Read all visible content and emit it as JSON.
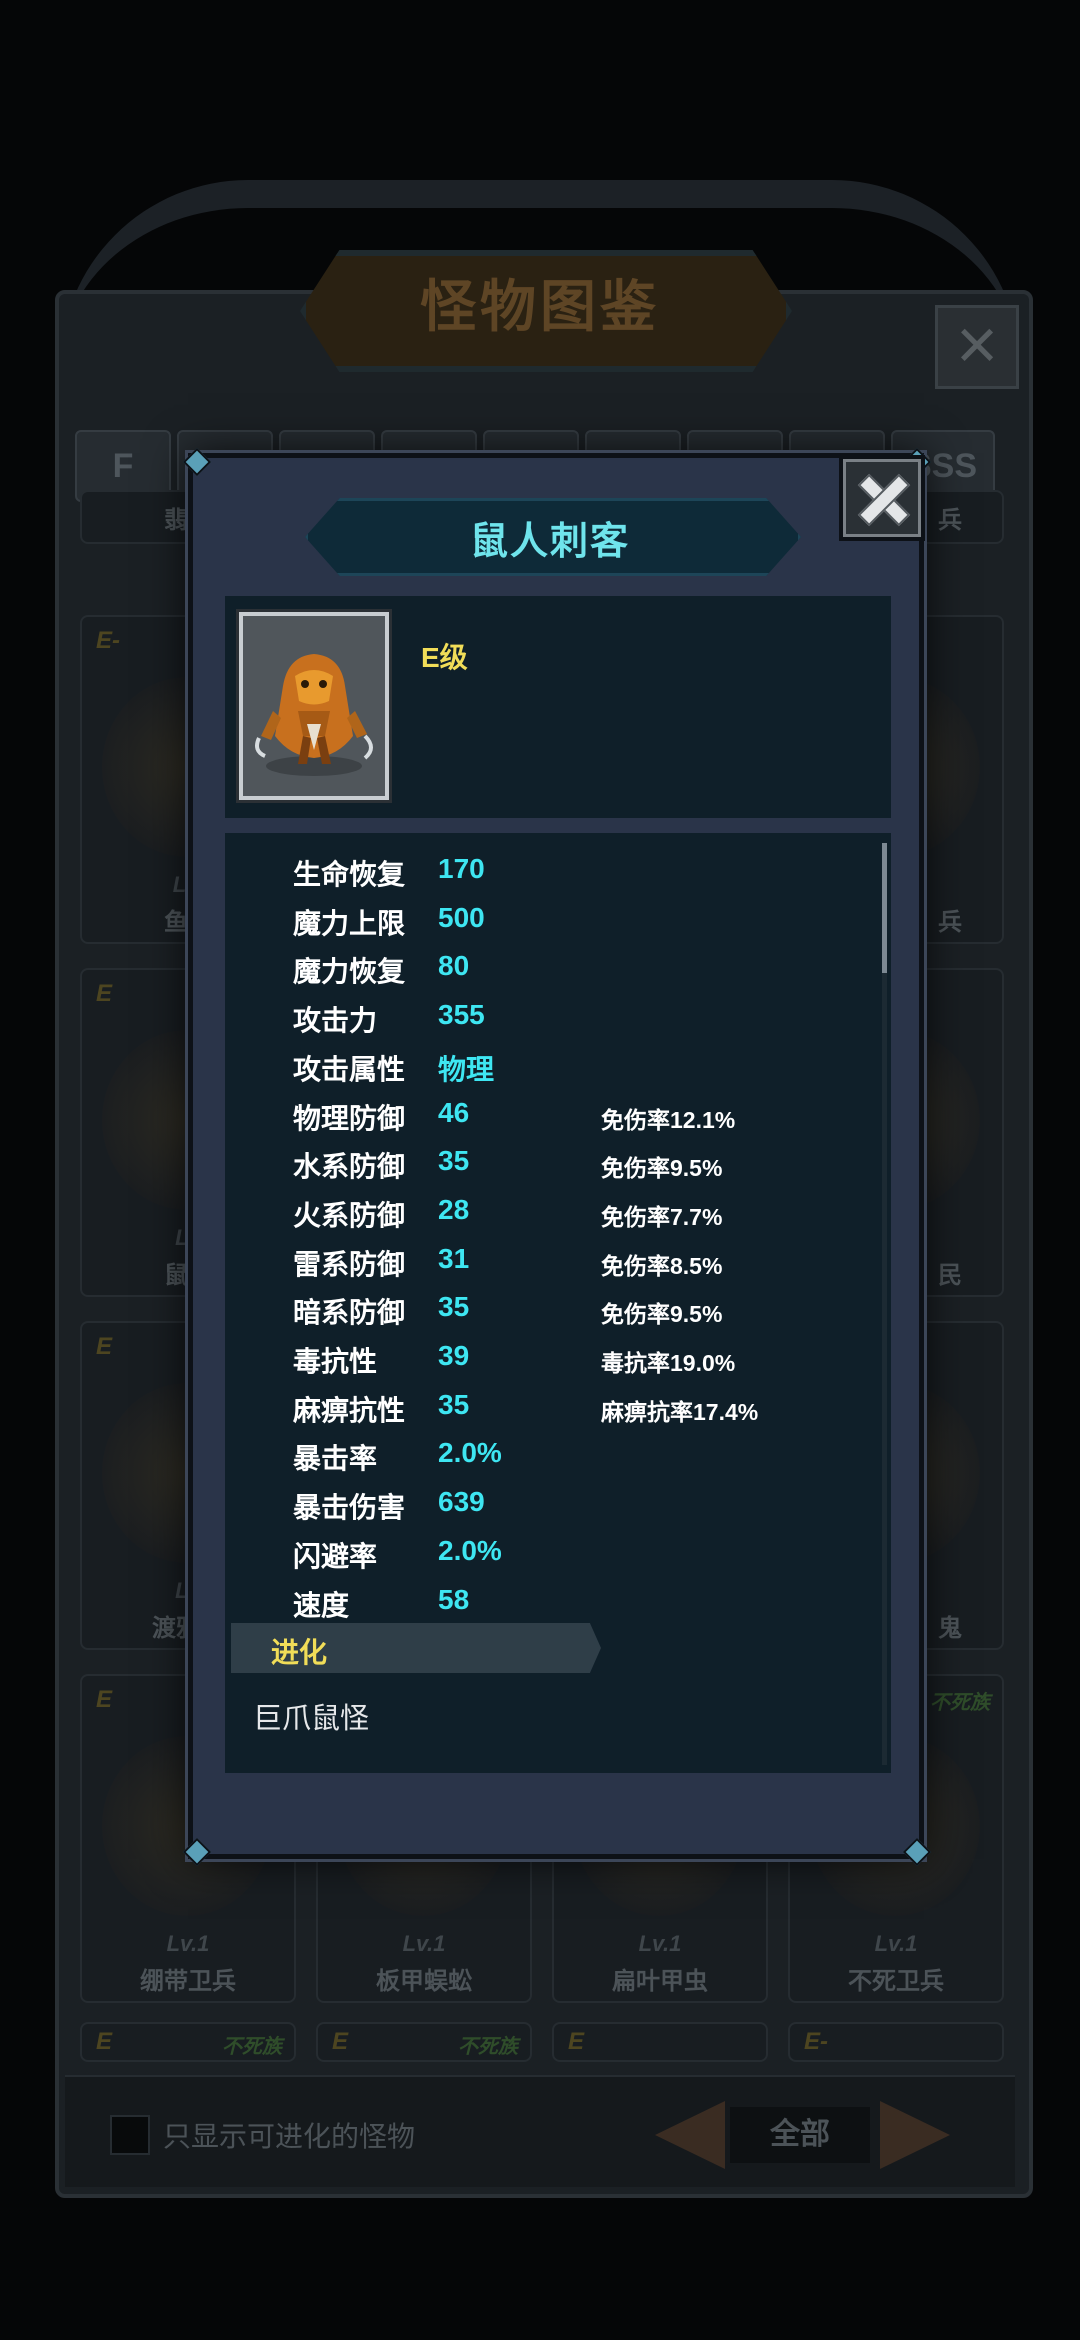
{
  "background": {
    "title": "怪物图鉴",
    "close_icon": "close-icon",
    "tabs": [
      "F",
      "",
      "",
      "",
      "",
      "",
      "",
      "",
      "SSS"
    ],
    "cards": [
      {
        "grade": "",
        "tag": "",
        "level": "",
        "name": "翡翠"
      },
      {
        "grade": "",
        "tag": "",
        "level": "",
        "name": "兵"
      },
      {
        "grade": "E-",
        "tag": "",
        "level": "Lv.",
        "name": "鱼人"
      },
      {
        "grade": "",
        "tag": "",
        "level": "",
        "name": "兵"
      },
      {
        "grade": "E",
        "tag": "",
        "level": "Lv",
        "name": "鼠人"
      },
      {
        "grade": "",
        "tag": "",
        "level": "",
        "name": "民"
      },
      {
        "grade": "E",
        "tag": "",
        "level": "Lv",
        "name": "渡鸦炼"
      },
      {
        "grade": "",
        "tag": "",
        "level": "",
        "name": "鬼"
      },
      {
        "grade": "E",
        "tag": "",
        "level": "Lv.1",
        "name": "绷带卫兵"
      },
      {
        "grade": "",
        "tag": "",
        "level": "Lv.1",
        "name": "板甲蜈蚣"
      },
      {
        "grade": "",
        "tag": "",
        "level": "Lv.1",
        "name": "扁叶甲虫"
      },
      {
        "grade": "",
        "tag": "不死族",
        "level": "Lv.1",
        "name": "不死卫兵"
      },
      {
        "grade": "E",
        "tag": "不死族",
        "level": "",
        "name": ""
      },
      {
        "grade": "E",
        "tag": "不死族",
        "level": "",
        "name": ""
      },
      {
        "grade": "E",
        "tag": "",
        "level": "",
        "name": ""
      },
      {
        "grade": "E-",
        "tag": "",
        "level": "",
        "name": ""
      }
    ],
    "filter_label": "只显示可进化的怪物",
    "all_label": "全部",
    "prev_icon": "arrow-left-icon",
    "next_icon": "arrow-right-icon"
  },
  "dialog": {
    "title": "鼠人刺客",
    "close_icon": "close-icon",
    "portrait_icon": "rat-assassin-portrait",
    "grade": "E级",
    "stats": [
      {
        "label": "生命恢复",
        "value": "170",
        "extra": ""
      },
      {
        "label": "魔力上限",
        "value": "500",
        "extra": ""
      },
      {
        "label": "魔力恢复",
        "value": "80",
        "extra": ""
      },
      {
        "label": "攻击力",
        "value": "355",
        "extra": ""
      },
      {
        "label": "攻击属性",
        "value": "物理",
        "extra": ""
      },
      {
        "label": "物理防御",
        "value": "46",
        "extra": "免伤率12.1%"
      },
      {
        "label": "水系防御",
        "value": "35",
        "extra": "免伤率9.5%"
      },
      {
        "label": "火系防御",
        "value": "28",
        "extra": "免伤率7.7%"
      },
      {
        "label": "雷系防御",
        "value": "31",
        "extra": "免伤率8.5%"
      },
      {
        "label": "暗系防御",
        "value": "35",
        "extra": "免伤率9.5%"
      },
      {
        "label": "毒抗性",
        "value": "39",
        "extra": "毒抗率19.0%"
      },
      {
        "label": "麻痹抗性",
        "value": "35",
        "extra": "麻痹抗率17.4%"
      },
      {
        "label": "暴击率",
        "value": "2.0%",
        "extra": ""
      },
      {
        "label": "暴击伤害",
        "value": "639",
        "extra": ""
      },
      {
        "label": "闪避率",
        "value": "2.0%",
        "extra": ""
      },
      {
        "label": "速度",
        "value": "58",
        "extra": ""
      }
    ],
    "evolution_label": "进化",
    "evolution_target": "巨爪鼠怪",
    "scroll_position": 0.0
  }
}
